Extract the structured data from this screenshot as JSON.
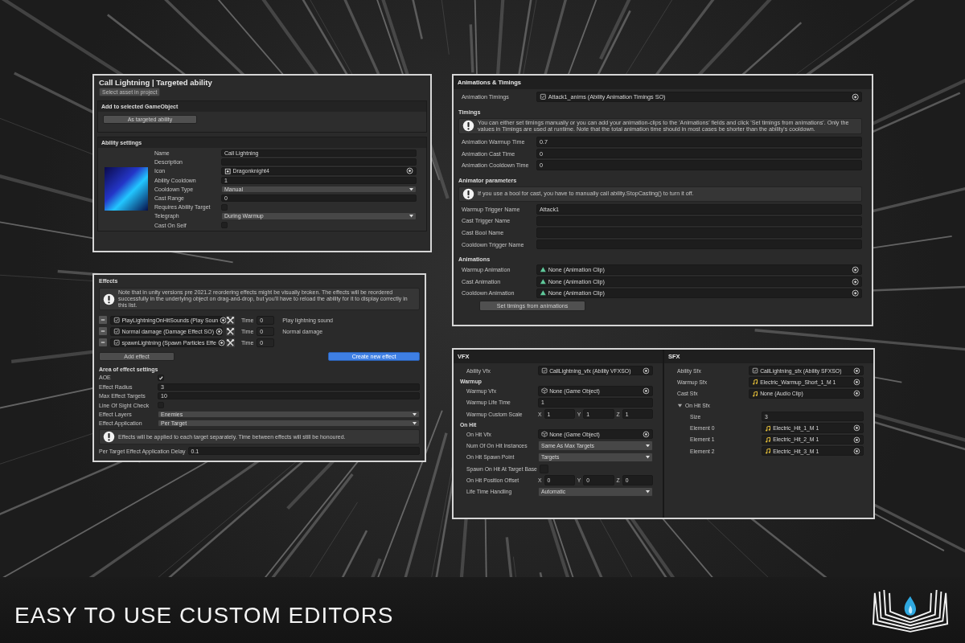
{
  "ability": {
    "title": "Call Lightning | Targeted ability",
    "select_button": "Select asset in project",
    "add_section": {
      "heading": "Add to selected GameObject",
      "button": "As targeted ability"
    },
    "settings": {
      "heading": "Ability settings",
      "fields": [
        {
          "kind": "text",
          "label": "Name",
          "value": "Call Lightning"
        },
        {
          "kind": "text",
          "label": "Description"
        },
        {
          "kind": "sprite_ref",
          "label": "Icon",
          "value": "Dragonknight4"
        },
        {
          "kind": "text",
          "label": "Ability Cooldown",
          "value": "1"
        },
        {
          "kind": "dropdown",
          "label": "Cooldown Type",
          "value": "Manual"
        },
        {
          "kind": "text",
          "label": "Cast Range",
          "value": "0"
        },
        {
          "kind": "checkbox",
          "label": "Requires Ability Target",
          "checked": false
        },
        {
          "kind": "dropdown",
          "label": "Telegraph",
          "value": "During Warmup"
        },
        {
          "kind": "checkbox",
          "label": "Cast On Self",
          "checked": false
        }
      ]
    }
  },
  "effects": {
    "title": "Effects",
    "note": "Note that in unity versions pre 2021.2 reordering effects might be visually broken. The effects will be reordered successfully in the underlying object on drag-and-drop, but you'll have to reload the ability for it to display correctly in this list.",
    "items": [
      {
        "name": "PlayLightningOnHitSounds (Play Soun",
        "time_label": "Time",
        "time": "0",
        "description": "Play lightning sound"
      },
      {
        "name": "Normal damage (Damage Effect SO)",
        "time_label": "Time",
        "time": "0",
        "description": "Normal damage"
      },
      {
        "name": "spawnLightning (Spawn Particles Effe",
        "time_label": "Time",
        "time": "0"
      }
    ],
    "add_button": "Add effect",
    "create_button": "Create new effect",
    "aoe_heading": "Area of effect settings",
    "aoe_fields": [
      {
        "kind": "checkbox",
        "label": "AOE",
        "checked": true
      },
      {
        "kind": "text",
        "label": "Effect Radius",
        "value": "3"
      },
      {
        "kind": "text",
        "label": "Max Effect Targets",
        "value": "10"
      },
      {
        "kind": "checkbox",
        "label": "Line Of Sight Check",
        "checked": false
      },
      {
        "kind": "dropdown",
        "label": "Effect Layers",
        "value": "Enemies"
      },
      {
        "kind": "dropdown",
        "label": "Effect Application",
        "value": "Per Target"
      }
    ],
    "aoe_note": "Effects will be applied to each target separately. Time between effects will still be honoured.",
    "delay": {
      "label": "Per Target Effect Application Delay",
      "value": "0.1"
    }
  },
  "animations": {
    "title": "Animations & Timings",
    "blocks": [
      {
        "kind": "so_ref",
        "label": "Animation Timings",
        "value": "Attack1_anims (Ability Animation Timings SO)"
      },
      {
        "kind": "heading",
        "label": "Timings"
      },
      {
        "kind": "note",
        "label": "You can either set timings manually or you can add your animation-clips to the 'Animations' fields and click 'Set timings from animations'. Only the values in Timings are used at runtime. Note that the total animation time should in most cases be shorter than the ability's cooldown."
      },
      {
        "kind": "text",
        "label": "Animation Warmup Time",
        "value": "0.7"
      },
      {
        "kind": "text",
        "label": "Animation Cast Time",
        "value": "0"
      },
      {
        "kind": "text",
        "label": "Animation Cooldown Time",
        "value": "0"
      },
      {
        "kind": "heading",
        "label": "Animator parameters"
      },
      {
        "kind": "note",
        "label": "If you use a bool for cast, you have to manually call ability.StopCasting() to turn it off."
      },
      {
        "kind": "text",
        "label": "Warmup Trigger Name",
        "value": "Attack1"
      },
      {
        "kind": "text",
        "label": "Cast Trigger Name"
      },
      {
        "kind": "text",
        "label": "Cast Bool Name"
      },
      {
        "kind": "text",
        "label": "Cooldown Trigger Name"
      },
      {
        "kind": "heading",
        "label": "Animations"
      },
      {
        "kind": "clip_ref",
        "label": "Warmup Animation",
        "value": "None (Animation Clip)"
      },
      {
        "kind": "clip_ref",
        "label": "Cast Animation",
        "value": "None (Animation Clip)"
      },
      {
        "kind": "clip_ref",
        "label": "Cooldown Animation",
        "value": "None (Animation Clip)"
      },
      {
        "kind": "button",
        "label": "Set timings from animations"
      }
    ]
  },
  "vfx": {
    "title": "VFX",
    "blocks": [
      {
        "kind": "so_ref",
        "label": "Ability Vfx",
        "value": "CallLightning_vfx (Ability VFXSO)"
      },
      {
        "kind": "heading",
        "label": "Warmup"
      },
      {
        "kind": "prefab_ref",
        "label": "Warmup Vfx",
        "value": "None (Game Object)"
      },
      {
        "kind": "text",
        "label": "Warmup Life Time",
        "value": "1"
      },
      {
        "kind": "vector",
        "label": "Warmup Custom Scale",
        "components": [
          {
            "axis": "X",
            "value": "1"
          },
          {
            "axis": "Y",
            "value": "1"
          },
          {
            "axis": "Z",
            "value": "1"
          }
        ]
      },
      {
        "kind": "heading",
        "label": "On Hit"
      },
      {
        "kind": "prefab_ref",
        "label": "On Hit Vfx",
        "value": "None (Game Object)"
      },
      {
        "kind": "dropdown",
        "label": "Num Of On Hit Instances",
        "value": "Same As Max Targets"
      },
      {
        "kind": "dropdown",
        "label": "On Hit Spawn Point",
        "value": "Targets"
      },
      {
        "kind": "checkbox",
        "label": "Spawn On Hit At Target Base",
        "checked": false
      },
      {
        "kind": "vector",
        "label": "On Hit Position Offset",
        "components": [
          {
            "axis": "X",
            "value": "0"
          },
          {
            "axis": "Y",
            "value": "0"
          },
          {
            "axis": "Z",
            "value": "0"
          }
        ]
      },
      {
        "kind": "dropdown",
        "label": "Life Time Handling",
        "value": "Automatic"
      }
    ]
  },
  "sfx": {
    "title": "SFX",
    "blocks": [
      {
        "kind": "so_ref",
        "label": "Ability Sfx",
        "value": "CallLightning_sfx (Ability SFXSO)"
      },
      {
        "kind": "audio_ref",
        "label": "Warmup Sfx",
        "value": "Electric_Warmup_Short_1_M 1"
      },
      {
        "kind": "audio_ref",
        "label": "Cast Sfx",
        "value": "None (Audio Clip)"
      },
      {
        "kind": "foldout",
        "label": "On Hit Sfx",
        "expanded": true,
        "children": [
          {
            "kind": "text",
            "label": "Size",
            "value": "3"
          },
          {
            "kind": "audio_ref",
            "label": "Element 0",
            "value": "Electric_Hit_1_M 1"
          },
          {
            "kind": "audio_ref",
            "label": "Element 1",
            "value": "Electric_Hit_2_M 1"
          },
          {
            "kind": "audio_ref",
            "label": "Element 2",
            "value": "Electric_Hit_3_M 1"
          }
        ]
      }
    ]
  },
  "footer": {
    "headline": "EASY TO USE CUSTOM EDITORS"
  }
}
